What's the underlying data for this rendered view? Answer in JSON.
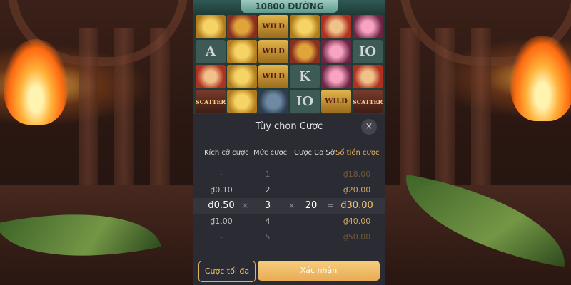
{
  "game": {
    "banner_text": "10800 ĐƯỜNG",
    "symbols": [
      [
        "",
        "",
        "WILD",
        "",
        "",
        ""
      ],
      [
        "A",
        "",
        "WILD",
        "",
        "",
        "IO"
      ],
      [
        "",
        "",
        "WILD",
        "K",
        "",
        ""
      ],
      [
        "SCATTER",
        "",
        "",
        "IO",
        "WILD",
        "SCATTER"
      ]
    ]
  },
  "bet_panel": {
    "title": "Tùy chọn Cược",
    "close_icon": "×",
    "columns": {
      "bet_size": "Kích cỡ cược",
      "bet_level": "Mức cược",
      "base_bet": "Cược Cơ Sở",
      "bet_amount": "Số tiền cược"
    },
    "rows": [
      {
        "bet_size": "-",
        "bet_level": "1",
        "base_bet": "",
        "bet_amount": "₫18.00"
      },
      {
        "bet_size": "₫0.10",
        "bet_level": "2",
        "base_bet": "",
        "bet_amount": "₫20.00"
      },
      {
        "bet_size": "₫0.50",
        "bet_level": "3",
        "base_bet": "20",
        "bet_amount": "₫30.00"
      },
      {
        "bet_size": "₫1.00",
        "bet_level": "4",
        "base_bet": "",
        "bet_amount": "₫40.00"
      },
      {
        "bet_size": "-",
        "bet_level": "5",
        "base_bet": "",
        "bet_amount": "₫50.00"
      }
    ],
    "selected_row": 2,
    "operators": {
      "times": "×",
      "equals": "="
    },
    "max_bet_label": "Cược tối đa",
    "confirm_label": "Xác nhận",
    "accent_color": "#e8ac55"
  }
}
